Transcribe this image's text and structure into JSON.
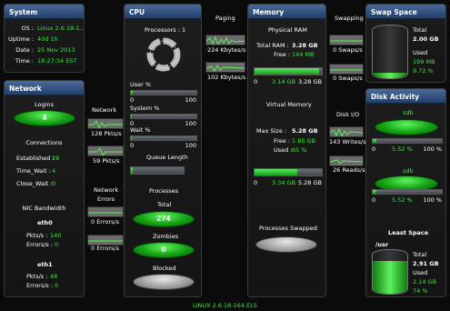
{
  "system": {
    "title": "System",
    "os_label": "OS :",
    "os_value": "Linux 2.6.18-1...",
    "uptime_label": "Uptime :",
    "uptime_value": "40d 1h",
    "date_label": "Date :",
    "date_value": "25 Nov 2013",
    "time_label": "Time :",
    "time_value": "18:27:34 EST"
  },
  "network": {
    "title": "Network",
    "logins_label": "Logins",
    "logins_value": "4",
    "connections_label": "Connections",
    "established_label": "Established :",
    "established_value": "28",
    "timewait_label": "Time_Wait :",
    "timewait_value": "4",
    "closewait_label": "Close_Wait :",
    "closewait_value": "0",
    "nic_label": "NIC Bandwidth",
    "eth0": {
      "name": "eth0",
      "pkts_label": "Pkts/s :",
      "pkts_value": "140",
      "errors_label": "Errors/s :",
      "errors_value": "0"
    },
    "eth1": {
      "name": "eth1",
      "pkts_label": "Pkts/s :",
      "pkts_value": "48",
      "errors_label": "Errors/s :",
      "errors_value": "0"
    }
  },
  "conn_network": {
    "title": "Network",
    "rate1": "128 Pkts/s",
    "rate2": "59 Pkts/s",
    "errors_title": "Network\nErrors",
    "err1": "0 Errors/s",
    "err2": "0 Errors/s"
  },
  "cpu": {
    "title": "CPU",
    "processors_label": "Processors :",
    "processors_value": "1",
    "user_label": "User %",
    "user_pct": 0.03,
    "system_label": "System %",
    "system_pct": 0.02,
    "wait_label": "Wait %",
    "wait_pct": 0.01,
    "scale_min": "0",
    "scale_max": "100",
    "queue_label": "Queue Length",
    "queue_pct": 0.04,
    "processes_label": "Processes",
    "total_label": "Total",
    "total_value": "274",
    "zombies_label": "Zombies",
    "zombies_value": "0",
    "blocked_label": "Blocked",
    "blocked_value": ""
  },
  "conn_paging": {
    "title": "Paging",
    "rate1": "224 Kbytes/s",
    "rate2": "102 Kbytes/s"
  },
  "memory": {
    "title": "Memory",
    "physical_label": "Physical RAM",
    "total_label": "Total RAM :",
    "total_value": "3.28 GB",
    "free_label": "Free :",
    "free_value": "144 MB",
    "phys_bar_left": "0",
    "phys_bar_mid": "3.14 GB",
    "phys_bar_right": "3.28 GB",
    "phys_used_pct": 0.957,
    "virtual_label": "Virtual Memory",
    "max_label": "Max Size :",
    "max_value": "5.28 GB",
    "vfree_label": "Free :",
    "vfree_value": "1.85 GB",
    "vused_label": "Used :",
    "vused_value": "65 %",
    "virt_bar_left": "0",
    "virt_bar_mid": "3.34 GB",
    "virt_bar_right": "5.28 GB",
    "virt_used_pct": 0.633,
    "swapped_label": "Processes Swapped"
  },
  "conn_swapping": {
    "title": "Swapping",
    "rate1": "0 Swaps/s",
    "rate2": "0 Swaps/s"
  },
  "conn_diskio": {
    "title": "Disk I/O",
    "rate1": "143 Writes/s",
    "rate2": "26 Reads/s"
  },
  "swap": {
    "title": "Swap Space",
    "total_label": "Total",
    "total_value": "2.00 GB",
    "used_label": "Used",
    "used_value": "199 MB",
    "pct_value": "9.72 %",
    "fill_pct": 0.0972
  },
  "disk": {
    "title": "Disk Activity",
    "sda1": {
      "name": "sdb",
      "left": "0",
      "pct": "5.52 %",
      "right": "100 %",
      "fill_pct": 0.0552
    },
    "sda2": {
      "name": "sdb",
      "left": "0",
      "pct": "5.52 %",
      "right": "100 %",
      "fill_pct": 0.0552
    },
    "least_label": "Least Space",
    "mount": "/usr",
    "total_label": "Total",
    "total_value": "2.91 GB",
    "used_label": "Used",
    "used_value": "2.14 GB",
    "used_pct": "74 %",
    "fill_pct": 0.74
  },
  "footer": "LINUX 2.6.18-164.EL5",
  "colors": {
    "accent_green": "#39e839",
    "header_blue": "#203f6c"
  }
}
